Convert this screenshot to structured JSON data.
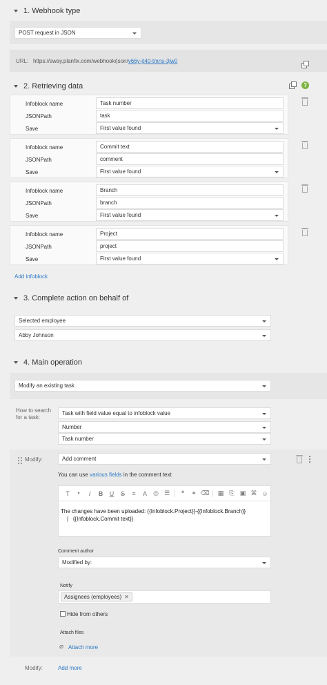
{
  "sections": {
    "webhook_type": "1. Webhook type",
    "retrieving": "2. Retrieving data",
    "complete_action": "3. Complete action on behalf of",
    "main_operation": "4. Main operation"
  },
  "webhook": {
    "type_value": "POST request in JSON",
    "url_label": "URL:",
    "url_prefix": "https://sway.planfix.com/webhook/json/",
    "url_token": "v66y-jt40-tmns-3jw0"
  },
  "infoblock_labels": {
    "name": "Infoblock name",
    "path": "JSONPath",
    "save": "Save"
  },
  "infoblocks": [
    {
      "name": "Task number",
      "path": "task",
      "save": "First value found"
    },
    {
      "name": "Commit text",
      "path": "comment",
      "save": "First value found"
    },
    {
      "name": "Branch",
      "path": "branch",
      "save": "First value found"
    },
    {
      "name": "Project",
      "path": "project",
      "save": "First value found"
    }
  ],
  "add_infoblock": "Add infoblock",
  "on_behalf": {
    "type": "Selected employee",
    "employee": "Abby Johnson"
  },
  "main": {
    "operation": "Modify an existing task",
    "search_label_1": "How to search",
    "search_label_2": "for a task:",
    "search_method": "Task with field value equal to infoblock value",
    "search_field": "Number",
    "search_infoblock": "Task number",
    "modify_label": "Modify:",
    "modify_value": "Add comment",
    "hint_pre": "You can use ",
    "hint_link": "various fields",
    "hint_post": " in the comment text",
    "comment_line1": "The changes have been uploaded: {{Infoblock.Project}}-{{Infoblock.Branch}}",
    "comment_line2": "|   {{Infoblock.Commit text}}",
    "author_label": "Comment author",
    "author_value": "Modified by:",
    "notify_label": "Notify",
    "notify_chip": "Assignees (employees)",
    "hide_label": "Hide from others",
    "attach_label": "Attach files",
    "attach_link": "Attach more",
    "modify2_label": "Modify:",
    "add_more": "Add more"
  },
  "toolbar": {
    "text_style": "T",
    "italic": "I",
    "bold": "B",
    "underline": "U",
    "strike": "S"
  },
  "colors": {
    "accent_link": "#2b78c5",
    "help_green": "#7cb342"
  },
  "icons": [
    "caret-down-icon",
    "copy-icon",
    "help-icon",
    "trash-icon",
    "more-icon",
    "drag-handle-icon",
    "paperclip-icon",
    "chip-close-icon"
  ]
}
